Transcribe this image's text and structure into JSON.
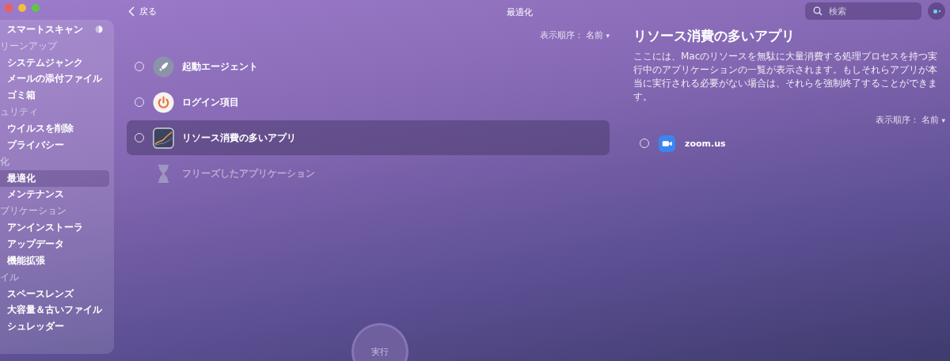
{
  "sidebar": {
    "items": [
      {
        "kind": "item",
        "label": "スマートスキャン",
        "selected": false,
        "progress_icon": true
      },
      {
        "kind": "section",
        "label": "リーンアップ"
      },
      {
        "kind": "item",
        "label": "システムジャンク",
        "selected": false
      },
      {
        "kind": "item",
        "label": "メールの添付ファイル",
        "selected": false
      },
      {
        "kind": "item",
        "label": "ゴミ箱",
        "selected": false
      },
      {
        "kind": "section",
        "label": "ュリティ"
      },
      {
        "kind": "item",
        "label": "ウイルスを削除",
        "selected": false
      },
      {
        "kind": "item",
        "label": "プライバシー",
        "selected": false
      },
      {
        "kind": "section",
        "label": "化"
      },
      {
        "kind": "item",
        "label": "最適化",
        "selected": true
      },
      {
        "kind": "item",
        "label": "メンテナンス",
        "selected": false
      },
      {
        "kind": "section",
        "label": "プリケーション"
      },
      {
        "kind": "item",
        "label": "アンインストーラ",
        "selected": false
      },
      {
        "kind": "item",
        "label": "アップデータ",
        "selected": false
      },
      {
        "kind": "item",
        "label": "機能拡張",
        "selected": false
      },
      {
        "kind": "section",
        "label": "イル"
      },
      {
        "kind": "item",
        "label": "スペースレンズ",
        "selected": false
      },
      {
        "kind": "item",
        "label": "大容量＆古いファイル",
        "selected": false
      },
      {
        "kind": "item",
        "label": "シュレッダー",
        "selected": false
      }
    ]
  },
  "toolbar": {
    "back": "戻る",
    "title": "最適化",
    "search": {
      "placeholder": "検索"
    }
  },
  "main": {
    "sort": {
      "label": "表示順序：",
      "value": "名前",
      "caret": "▾"
    },
    "items": [
      {
        "kind": "rocket",
        "label": "起動エージェント",
        "selected": false,
        "checked": false,
        "disabled": false
      },
      {
        "kind": "power",
        "label": "ログイン項目",
        "selected": false,
        "checked": false,
        "disabled": false
      },
      {
        "kind": "chart",
        "label": "リソース消費の多いアプリ",
        "selected": true,
        "checked": false,
        "disabled": false
      },
      {
        "kind": "hourglass",
        "label": "フリーズしたアプリケーション",
        "selected": false,
        "disabled": true
      }
    ],
    "run_button": {
      "label": "実行",
      "disabled": true
    }
  },
  "detail": {
    "title": "リソース消費の多いアプリ",
    "description": "ここには、Macのリソースを無駄に大量消費する処理プロセスを持つ実行中のアプリケーションの一覧が表示されます。もしそれらアプリが本当に実行される必要がない場合は、それらを強制終了することができます。",
    "sort": {
      "label": "表示順序：",
      "value": "名前",
      "caret": "▾"
    },
    "apps": [
      {
        "name": "zoom.us",
        "checked": false
      }
    ]
  }
}
